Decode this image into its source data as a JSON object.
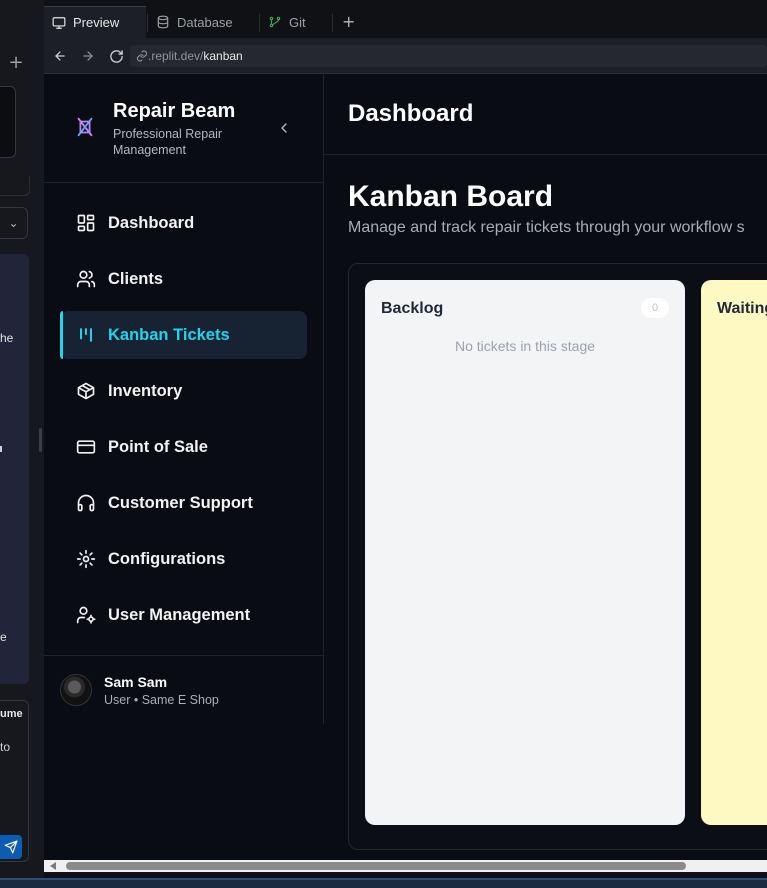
{
  "left_strip": {
    "plus_icon": "+",
    "chevron_icon": "⌄",
    "text_fragment_1": "he",
    "text_fragment_2": "e",
    "panel_title_fragment": "ume",
    "panel_text_fragment": "to",
    "send_icon": "send-icon"
  },
  "browser": {
    "tabs": [
      {
        "label": "Preview",
        "icon": "monitor-icon",
        "active": true
      },
      {
        "label": "Database",
        "icon": "database-icon",
        "active": false
      },
      {
        "label": "Git",
        "icon": "git-branch-icon",
        "active": false
      }
    ],
    "new_tab": "+",
    "url_host": ".replit.dev/",
    "url_path": "kanban"
  },
  "sidebar": {
    "brand": "Repair Beam",
    "tagline": "Professional Repair Management",
    "items": [
      {
        "label": "Dashboard",
        "icon": "dashboard-icon"
      },
      {
        "label": "Clients",
        "icon": "users-icon"
      },
      {
        "label": "Kanban Tickets",
        "icon": "kanban-icon",
        "active": true
      },
      {
        "label": "Inventory",
        "icon": "box-icon"
      },
      {
        "label": "Point of Sale",
        "icon": "credit-card-icon"
      },
      {
        "label": "Customer Support",
        "icon": "headphones-icon"
      },
      {
        "label": "Configurations",
        "icon": "gear-icon"
      },
      {
        "label": "User Management",
        "icon": "user-cog-icon"
      }
    ],
    "user": {
      "name": "Sam Sam",
      "role": "User • Same E Shop"
    }
  },
  "main": {
    "header_title": "Dashboard",
    "board_title": "Kanban Board",
    "board_subtitle": "Manage and track repair tickets through your workflow s",
    "columns": [
      {
        "title": "Backlog",
        "count": "0",
        "empty_text": "No tickets in this stage",
        "color": "#f3f4f6"
      },
      {
        "title": "Waiting",
        "count": "",
        "empty_text": "",
        "color": "#fef9c3"
      }
    ]
  },
  "colors": {
    "accent": "#22d3ee",
    "background": "#090c12",
    "active_bg": "#172233"
  }
}
